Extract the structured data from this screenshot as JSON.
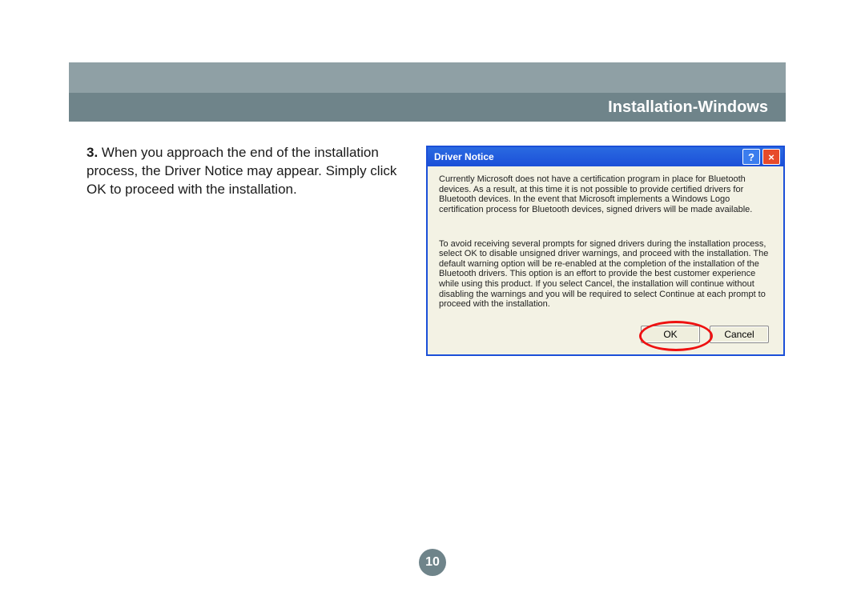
{
  "header": {
    "title": "Installation-Windows"
  },
  "body": {
    "step_number": "3.",
    "step_text": "When you approach the end of the installation process, the Driver Notice may appear. Simply click OK to proceed with the installation."
  },
  "dialog": {
    "title": "Driver Notice",
    "help_label": "?",
    "close_label": "×",
    "para1": "Currently Microsoft does not have a certification program in place for Bluetooth devices. As a result, at this time it is not possible to provide certified drivers for Bluetooth devices. In the event that Microsoft implements a Windows Logo certification process for Bluetooth devices, signed drivers will be made available.",
    "para2": "To avoid receiving several prompts for signed drivers during the installation process, select OK to disable unsigned driver warnings, and proceed with the installation. The default warning option will be re-enabled at the completion of the installation of the Bluetooth drivers. This option is an effort to provide the best customer experience while using this product. If you select Cancel, the installation will continue without disabling the warnings and you will be required to select Continue at each prompt to proceed with the installation.",
    "ok_label": "OK",
    "cancel_label": "Cancel"
  },
  "page_number": "10"
}
